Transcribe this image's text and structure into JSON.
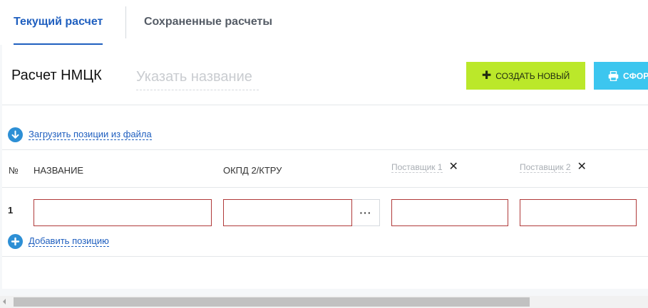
{
  "tabs": [
    {
      "label": "Текущий расчет",
      "active": true
    },
    {
      "label": "Сохраненные расчеты",
      "active": false
    }
  ],
  "header": {
    "title": "Расчет НМЦК",
    "name_placeholder": "Указать название",
    "name_value": "",
    "create_button": "СОЗДАТЬ НОВЫЙ",
    "print_button": "СФОРМИРОВАТЬ"
  },
  "upload_link": "Загрузить позиции из файла",
  "table": {
    "columns": {
      "num": "№",
      "name": "НАЗВАНИЕ",
      "okpd": "ОКПД 2/КТРУ"
    },
    "suppliers": [
      "Поставщик 1",
      "Поставщик 2"
    ],
    "rows": [
      {
        "num": "1",
        "name": "",
        "okpd": "",
        "supplier1": "",
        "supplier2": ""
      }
    ],
    "more_button": "···"
  },
  "add_position_link": "Добавить позицию",
  "colors": {
    "accent_blue": "#1f5fbf",
    "create_green": "#bbe82a",
    "print_cyan": "#3cc6ef",
    "invalid_border": "#b03a3a"
  }
}
